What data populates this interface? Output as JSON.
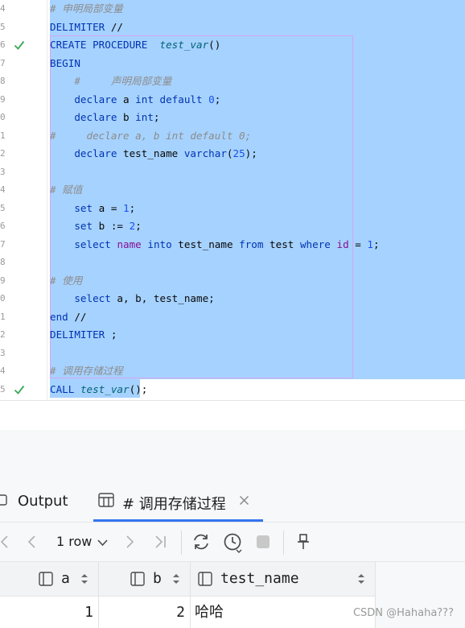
{
  "editor": {
    "lines": [
      {
        "n": "4",
        "check": false,
        "segs": [
          {
            "t": "# 申明局部变量",
            "c": "cm"
          }
        ]
      },
      {
        "n": "5",
        "check": false,
        "segs": [
          {
            "t": "DELIMITER",
            "c": "kw"
          },
          {
            "t": " //",
            "c": ""
          }
        ]
      },
      {
        "n": "6",
        "check": true,
        "segs": [
          {
            "t": "CREATE PROCEDURE",
            "c": "kw"
          },
          {
            "t": "  ",
            "c": ""
          },
          {
            "t": "test_var",
            "c": "fn"
          },
          {
            "t": "()",
            "c": ""
          }
        ]
      },
      {
        "n": "7",
        "check": false,
        "segs": [
          {
            "t": "BEGIN",
            "c": "kw"
          }
        ]
      },
      {
        "n": "8",
        "check": false,
        "segs": [
          {
            "t": "    #     声明局部变量",
            "c": "cm"
          }
        ]
      },
      {
        "n": "9",
        "check": false,
        "segs": [
          {
            "t": "    ",
            "c": ""
          },
          {
            "t": "declare",
            "c": "kw"
          },
          {
            "t": " a ",
            "c": ""
          },
          {
            "t": "int default",
            "c": "kw"
          },
          {
            "t": " ",
            "c": ""
          },
          {
            "t": "0",
            "c": "num"
          },
          {
            "t": ";",
            "c": ""
          }
        ]
      },
      {
        "n": "0",
        "check": false,
        "segs": [
          {
            "t": "    ",
            "c": ""
          },
          {
            "t": "declare",
            "c": "kw"
          },
          {
            "t": " b ",
            "c": ""
          },
          {
            "t": "int",
            "c": "kw"
          },
          {
            "t": ";",
            "c": ""
          }
        ]
      },
      {
        "n": "1",
        "check": false,
        "segs": [
          {
            "t": "#     declare a, b int default 0;",
            "c": "cm"
          }
        ]
      },
      {
        "n": "2",
        "check": false,
        "segs": [
          {
            "t": "    ",
            "c": ""
          },
          {
            "t": "declare",
            "c": "kw"
          },
          {
            "t": " test_name ",
            "c": ""
          },
          {
            "t": "varchar",
            "c": "kw"
          },
          {
            "t": "(",
            "c": ""
          },
          {
            "t": "25",
            "c": "num"
          },
          {
            "t": ");",
            "c": ""
          }
        ]
      },
      {
        "n": "3",
        "check": false,
        "segs": []
      },
      {
        "n": "4",
        "check": false,
        "segs": [
          {
            "t": "# 赋值",
            "c": "cm"
          }
        ]
      },
      {
        "n": "5",
        "check": false,
        "segs": [
          {
            "t": "    ",
            "c": ""
          },
          {
            "t": "set",
            "c": "kw"
          },
          {
            "t": " a = ",
            "c": ""
          },
          {
            "t": "1",
            "c": "num"
          },
          {
            "t": ";",
            "c": ""
          }
        ]
      },
      {
        "n": "6",
        "check": false,
        "segs": [
          {
            "t": "    ",
            "c": ""
          },
          {
            "t": "set",
            "c": "kw"
          },
          {
            "t": " b := ",
            "c": ""
          },
          {
            "t": "2",
            "c": "num"
          },
          {
            "t": ";",
            "c": ""
          }
        ]
      },
      {
        "n": "7",
        "check": false,
        "segs": [
          {
            "t": "    ",
            "c": ""
          },
          {
            "t": "select",
            "c": "kw"
          },
          {
            "t": " ",
            "c": ""
          },
          {
            "t": "name",
            "c": "col"
          },
          {
            "t": " ",
            "c": ""
          },
          {
            "t": "into",
            "c": "kw"
          },
          {
            "t": " test_name ",
            "c": ""
          },
          {
            "t": "from",
            "c": "kw"
          },
          {
            "t": " test ",
            "c": ""
          },
          {
            "t": "where",
            "c": "kw"
          },
          {
            "t": " ",
            "c": ""
          },
          {
            "t": "id",
            "c": "col"
          },
          {
            "t": " = ",
            "c": ""
          },
          {
            "t": "1",
            "c": "num"
          },
          {
            "t": ";",
            "c": ""
          }
        ]
      },
      {
        "n": "8",
        "check": false,
        "segs": []
      },
      {
        "n": "9",
        "check": false,
        "segs": [
          {
            "t": "# 使用",
            "c": "cm"
          }
        ]
      },
      {
        "n": "0",
        "check": false,
        "segs": [
          {
            "t": "    ",
            "c": ""
          },
          {
            "t": "select",
            "c": "kw"
          },
          {
            "t": " a, b, test_name;",
            "c": ""
          }
        ]
      },
      {
        "n": "1",
        "check": false,
        "segs": [
          {
            "t": "end",
            "c": "kw"
          },
          {
            "t": " //",
            "c": ""
          }
        ]
      },
      {
        "n": "2",
        "check": false,
        "segs": [
          {
            "t": "DELIMITER",
            "c": "kw"
          },
          {
            "t": " ;",
            "c": ""
          }
        ]
      },
      {
        "n": "3",
        "check": false,
        "segs": []
      },
      {
        "n": "4",
        "check": false,
        "segs": [
          {
            "t": "# 调用存储过程",
            "c": "cm"
          }
        ]
      },
      {
        "n": "5",
        "check": true,
        "segs": [
          {
            "t": "CALL",
            "c": "kw"
          },
          {
            "t": " ",
            "c": ""
          },
          {
            "t": "test_var",
            "c": "fn"
          },
          {
            "t": "();",
            "c": ""
          }
        ]
      }
    ]
  },
  "tabs": {
    "output_label": "Output",
    "result_label": "# 调用存储过程"
  },
  "toolbar": {
    "row_count": "1 row"
  },
  "grid": {
    "columns": [
      "a",
      "b",
      "test_name"
    ],
    "rows": [
      [
        "1",
        "2",
        "哈哈"
      ]
    ]
  },
  "watermark": "CSDN @Hahaha???",
  "colors": {
    "selection": "#a6d2ff",
    "keyword": "#0033b3",
    "accent": "#3574f0",
    "check": "#3da85c"
  }
}
